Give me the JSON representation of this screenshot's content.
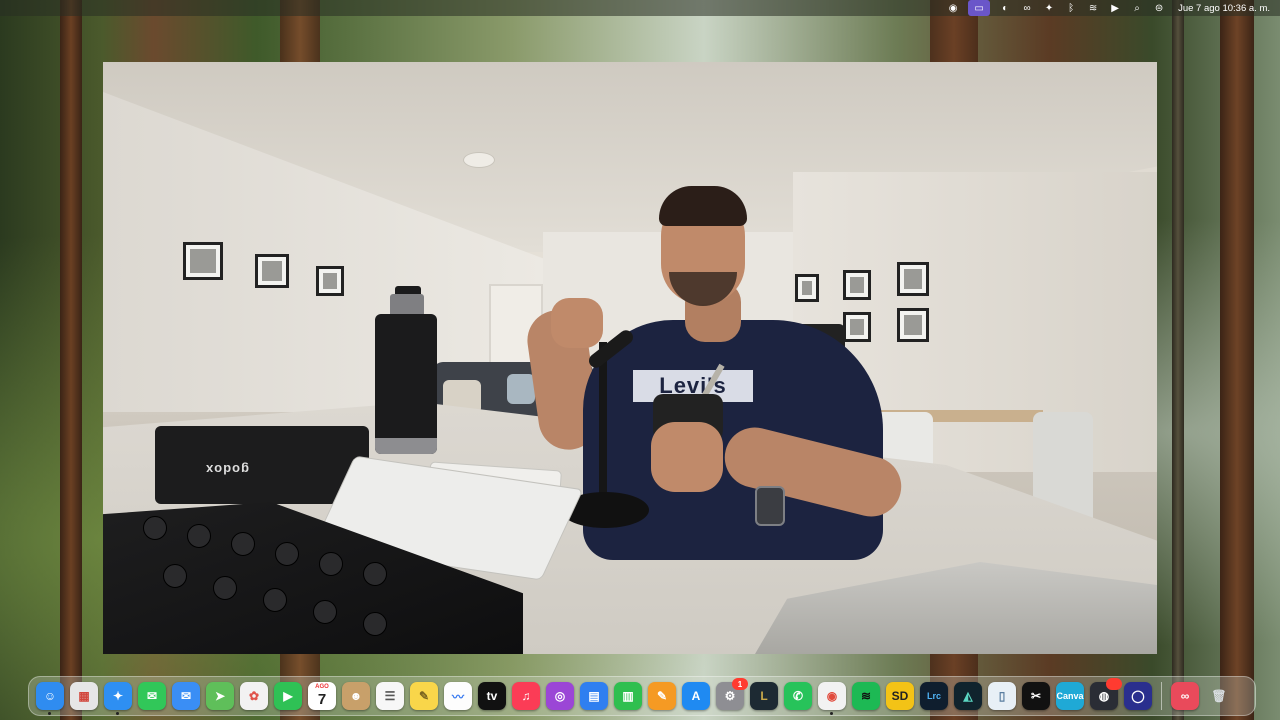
{
  "wallpaper": "forest",
  "menubar": {
    "apple_icon": "",
    "status_icons": [
      {
        "name": "screen-record-icon",
        "glyph": "◉"
      },
      {
        "name": "screen-mirroring-icon",
        "glyph": "▭",
        "highlight": true
      },
      {
        "name": "app-status-icon",
        "glyph": "◐"
      },
      {
        "name": "creative-cloud-icon",
        "glyph": "∞"
      },
      {
        "name": "app-badge-icon",
        "glyph": "✦"
      },
      {
        "name": "bluetooth-icon",
        "glyph": "ᛒ"
      },
      {
        "name": "wifi-icon",
        "glyph": "≋"
      },
      {
        "name": "now-playing-icon",
        "glyph": "▶"
      },
      {
        "name": "spotlight-search-icon",
        "glyph": "⌕"
      },
      {
        "name": "control-center-icon",
        "glyph": "⊜"
      }
    ],
    "clock": "Jue 7 ago  10:36 a. m."
  },
  "camera_window": {
    "shirt_logo": "Levi's",
    "camera_brand": "godox"
  },
  "dock": {
    "apps": [
      {
        "name": "finder",
        "label": "",
        "glyph": "☺",
        "color": "#2f8cf0",
        "running": true
      },
      {
        "name": "launchpad",
        "label": "",
        "glyph": "▦",
        "color": "#e6e6e6",
        "text": "#d2463c"
      },
      {
        "name": "safari",
        "label": "",
        "glyph": "✦",
        "color": "#2e8ff2",
        "running": true
      },
      {
        "name": "messages",
        "label": "",
        "glyph": "✉",
        "color": "#31c759"
      },
      {
        "name": "mail",
        "label": "",
        "glyph": "✉",
        "color": "#3a8ef5"
      },
      {
        "name": "maps",
        "label": "",
        "glyph": "➤",
        "color": "#5fbf5a"
      },
      {
        "name": "photos",
        "label": "",
        "glyph": "✿",
        "color": "#f2f2f2",
        "text": "#e0534a"
      },
      {
        "name": "facetime",
        "label": "",
        "glyph": "▶",
        "color": "#2fc155"
      },
      {
        "name": "calendar",
        "label": "7",
        "month": "AGO",
        "color": "#ffffff",
        "calendar": true
      },
      {
        "name": "contacts",
        "label": "",
        "glyph": "☻",
        "color": "#c8a06a"
      },
      {
        "name": "reminders",
        "label": "",
        "glyph": "☰",
        "color": "#f7f7f7",
        "text": "#555"
      },
      {
        "name": "notes",
        "label": "",
        "glyph": "✎",
        "color": "#f9d64a",
        "text": "#7a6420"
      },
      {
        "name": "freeform",
        "label": "",
        "glyph": "〰",
        "color": "#fdfdfd",
        "text": "#3a7bf0"
      },
      {
        "name": "apple-tv",
        "label": "tv",
        "glyph": "",
        "color": "#111111"
      },
      {
        "name": "music",
        "label": "",
        "glyph": "♫",
        "color": "#fb3c56"
      },
      {
        "name": "podcasts",
        "label": "",
        "glyph": "◎",
        "color": "#9b46d6"
      },
      {
        "name": "keynote",
        "label": "",
        "glyph": "▤",
        "color": "#2f7ff0"
      },
      {
        "name": "numbers",
        "label": "",
        "glyph": "▥",
        "color": "#2fbf4f"
      },
      {
        "name": "pages",
        "label": "",
        "glyph": "✎",
        "color": "#f59a23"
      },
      {
        "name": "app-store",
        "label": "",
        "glyph": "A",
        "color": "#1f8af2"
      },
      {
        "name": "system-settings",
        "label": "",
        "glyph": "⚙",
        "color": "#8e8e93",
        "badge": "1"
      },
      {
        "name": "league-of-legends",
        "label": "L",
        "glyph": "",
        "color": "#1d2a33",
        "text": "#c9a94a"
      },
      {
        "name": "whatsapp",
        "label": "",
        "glyph": "✆",
        "color": "#27c35a"
      },
      {
        "name": "chrome",
        "label": "",
        "glyph": "◉",
        "color": "#f2f2f2",
        "text": "#e14a3c",
        "running": true
      },
      {
        "name": "spotify",
        "label": "",
        "glyph": "≋",
        "color": "#1db954",
        "text": "#111"
      },
      {
        "name": "sd",
        "label": "SD",
        "glyph": "",
        "color": "#f3c316",
        "text": "#222"
      },
      {
        "name": "lightroom-classic",
        "label": "Lrc",
        "glyph": "",
        "color": "#0f1e2e",
        "text": "#4fb3f5"
      },
      {
        "name": "affinity",
        "label": "",
        "glyph": "◭",
        "color": "#10232d",
        "text": "#5bd6c2"
      },
      {
        "name": "iphone-mirroring",
        "label": "",
        "glyph": "▯",
        "color": "#e8f0f6",
        "text": "#5a7ea0"
      },
      {
        "name": "capcut",
        "label": "",
        "glyph": "✂",
        "color": "#111111"
      },
      {
        "name": "canva",
        "label": "Canva",
        "glyph": "",
        "color": "#1fa9d6"
      },
      {
        "name": "obs",
        "label": "",
        "glyph": "◍",
        "color": "#2a2d35",
        "badge": " "
      },
      {
        "name": "alexa",
        "label": "",
        "glyph": "◯",
        "color": "#2a2f8e"
      }
    ],
    "right_apps": [
      {
        "name": "creative-cloud",
        "label": "",
        "glyph": "∞",
        "color": "#e94a5b"
      },
      {
        "name": "trash",
        "label": "",
        "glyph": "🗑",
        "color": "transparent",
        "text": "#d8dde0"
      }
    ]
  }
}
